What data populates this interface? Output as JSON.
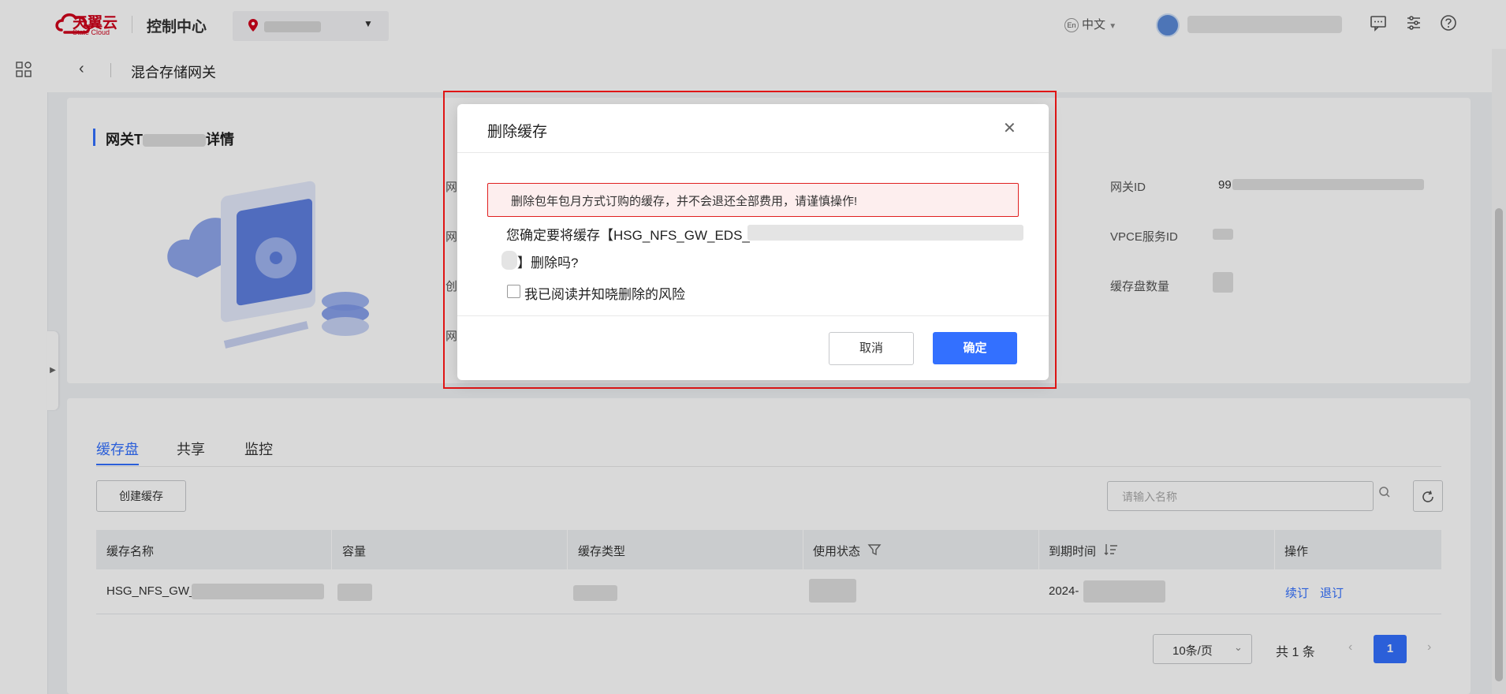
{
  "header": {
    "brand_cn": "天翼云",
    "brand_en": "State Cloud",
    "console_title": "控制中心",
    "language": "中文",
    "lang_badge": "En"
  },
  "breadcrumb": {
    "title": "混合存储网关"
  },
  "detail": {
    "title_prefix": "网关T",
    "title_suffix": "详情",
    "fields_right": [
      {
        "label": "网关ID",
        "value_prefix": "99"
      },
      {
        "label": "VPCE服务ID"
      },
      {
        "label": "缓存盘数量"
      }
    ],
    "fields_left_initials": [
      "网",
      "网",
      "创",
      "网"
    ]
  },
  "tabs": [
    {
      "label": "缓存盘",
      "active": true
    },
    {
      "label": "共享"
    },
    {
      "label": "监控"
    }
  ],
  "toolbar": {
    "create_label": "创建缓存",
    "search_placeholder": "请输入名称"
  },
  "table": {
    "headers": [
      "缓存名称",
      "容量",
      "缓存类型",
      "使用状态",
      "到期时间",
      "操作"
    ],
    "rows": [
      {
        "name_prefix": "HSG_NFS_GW_E",
        "expiry_prefix": "2024-",
        "ops": [
          "续订",
          "退订"
        ]
      }
    ]
  },
  "pagination": {
    "page_size": "10条/页",
    "total": "共 1 条",
    "current_page": "1"
  },
  "modal": {
    "title": "删除缓存",
    "warning": "删除包年包月方式订购的缓存，并不会退还全部费用，请谨慎操作!",
    "confirm_line1": "您确定要将缓存【HSG_NFS_GW_EDS_",
    "confirm_line2": "】删除吗?",
    "checkbox_label": "我已阅读并知晓删除的风险",
    "checkbox_checked": false,
    "cancel_label": "取消",
    "ok_label": "确定"
  },
  "colors": {
    "primary": "#3370ff",
    "brand_red": "#d0021b",
    "warning_border": "#e02020"
  },
  "icons": [
    "location-pin-icon",
    "chevron-down-icon",
    "user-avatar-icon",
    "message-icon",
    "settings-sliders-icon",
    "help-icon",
    "apps-grid-icon",
    "back-arrow-icon",
    "close-icon",
    "search-icon",
    "refresh-icon",
    "filter-icon",
    "sort-icon"
  ]
}
